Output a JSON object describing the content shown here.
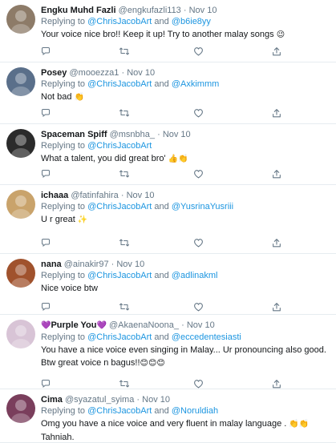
{
  "tweets": [
    {
      "name": "Engku Muhd Fazli",
      "handle": "@engkufazli113",
      "date": "Nov 10",
      "replying_prefix": "Replying to",
      "mention1": "@ChrisJacobArt",
      "and": "and",
      "mention2": "@b6ie8yy",
      "text": "Your voice nice bro!! Keep it up! Try to another malay songs",
      "emoji": "😉",
      "avatar_color": "#8d7b68"
    },
    {
      "name": "Posey",
      "handle": "@mooezza1",
      "date": "Nov 10",
      "replying_prefix": "Replying to",
      "mention1": "@ChrisJacobArt",
      "and": "and",
      "mention2": "@Axkimmm",
      "text": "Not bad",
      "emoji": "👏",
      "avatar_color": "#5a6f8a"
    },
    {
      "name": "Spaceman Spiff",
      "handle": "@msnbha_",
      "date": "Nov 10",
      "replying_prefix": "Replying to",
      "mention1": "@ChrisJacobArt",
      "and": "",
      "mention2": "",
      "text": "What a talent, you did great bro'",
      "emoji": "👍👏",
      "avatar_color": "#2b2b2b"
    },
    {
      "name": "ichaaa",
      "handle": "@fatinfahira",
      "date": "Nov 10",
      "replying_prefix": "Replying to",
      "mention1": "@ChrisJacobArt",
      "and": "and",
      "mention2": "@YusrinaYusriii",
      "text": "U r great",
      "emoji": "✨",
      "avatar_color": "#c9a36b"
    },
    {
      "name": "nana",
      "handle": "@ainakir97",
      "date": "Nov 10",
      "replying_prefix": "Replying to",
      "mention1": "@ChrisJacobArt",
      "and": "and",
      "mention2": "@adlinakml",
      "text": "Nice voice btw",
      "emoji": "",
      "avatar_color": "#a0522d"
    },
    {
      "name": "Purple You",
      "name_prefix_emoji": "💜",
      "name_suffix_emoji": "💜",
      "handle": "@AkaenaNoona_",
      "date": "Nov 10",
      "replying_prefix": "Replying to",
      "mention1": "@ChrisJacobArt",
      "and": "and",
      "mention2": "@eccedentesiasti",
      "text": "You have a nice voice even singing in Malay... Ur pronouncing also good.",
      "text2": "Btw great voice n bagus!!",
      "emoji": "😊😊😊",
      "avatar_color": "#d8c4d6"
    },
    {
      "name": "Cima",
      "handle": "@syazatul_syima",
      "date": "Nov 10",
      "replying_prefix": "Replying to",
      "mention1": "@ChrisJacobArt",
      "and": "and",
      "mention2": "@Noruldiah",
      "text": "Omg you have a nice voice and very fluent in malay language .",
      "emoji": "👏👏",
      "text2": "Tahniah.",
      "avatar_color": "#7a3e5c"
    }
  ],
  "dot": "·",
  "icons": [
    "reply-icon",
    "retweet-icon",
    "like-icon",
    "share-icon"
  ],
  "colors": {
    "mention": "#1b95e0",
    "muted": "#657786",
    "divider": "#e6ecf0"
  }
}
